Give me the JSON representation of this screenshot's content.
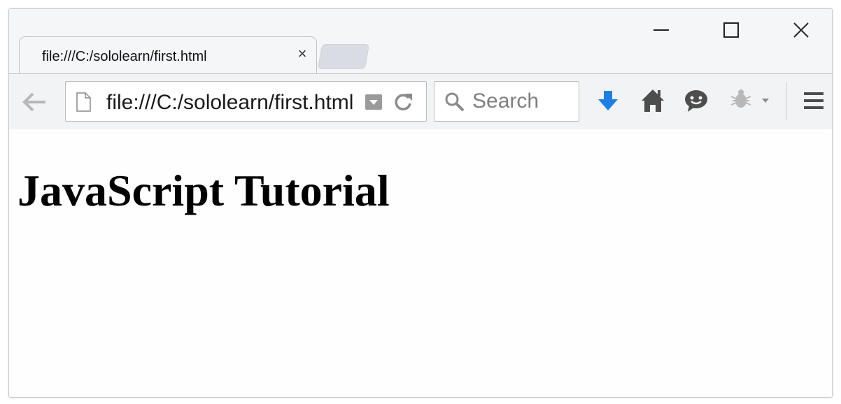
{
  "browser": {
    "tab": {
      "title": "file:///C:/sololearn/first.html",
      "close_glyph": "×"
    },
    "window_controls": [
      "minimize-icon",
      "maximize-icon",
      "close-icon"
    ],
    "toolbar": {
      "url": "file:///C:/sololearn/first.html",
      "search_placeholder": "Search",
      "icons": [
        "back-arrow-icon",
        "page-icon",
        "dropdown-icon",
        "reload-icon",
        "search-icon",
        "download-arrow-icon",
        "home-icon",
        "chat-bubble-icon",
        "bug-icon",
        "hamburger-menu-icon"
      ]
    },
    "colors": {
      "download_accent": "#1f7fe6",
      "icon_dark": "#4d4d4d",
      "icon_light": "#b8b8b8"
    }
  },
  "page": {
    "heading": "JavaScript Tutorial"
  }
}
